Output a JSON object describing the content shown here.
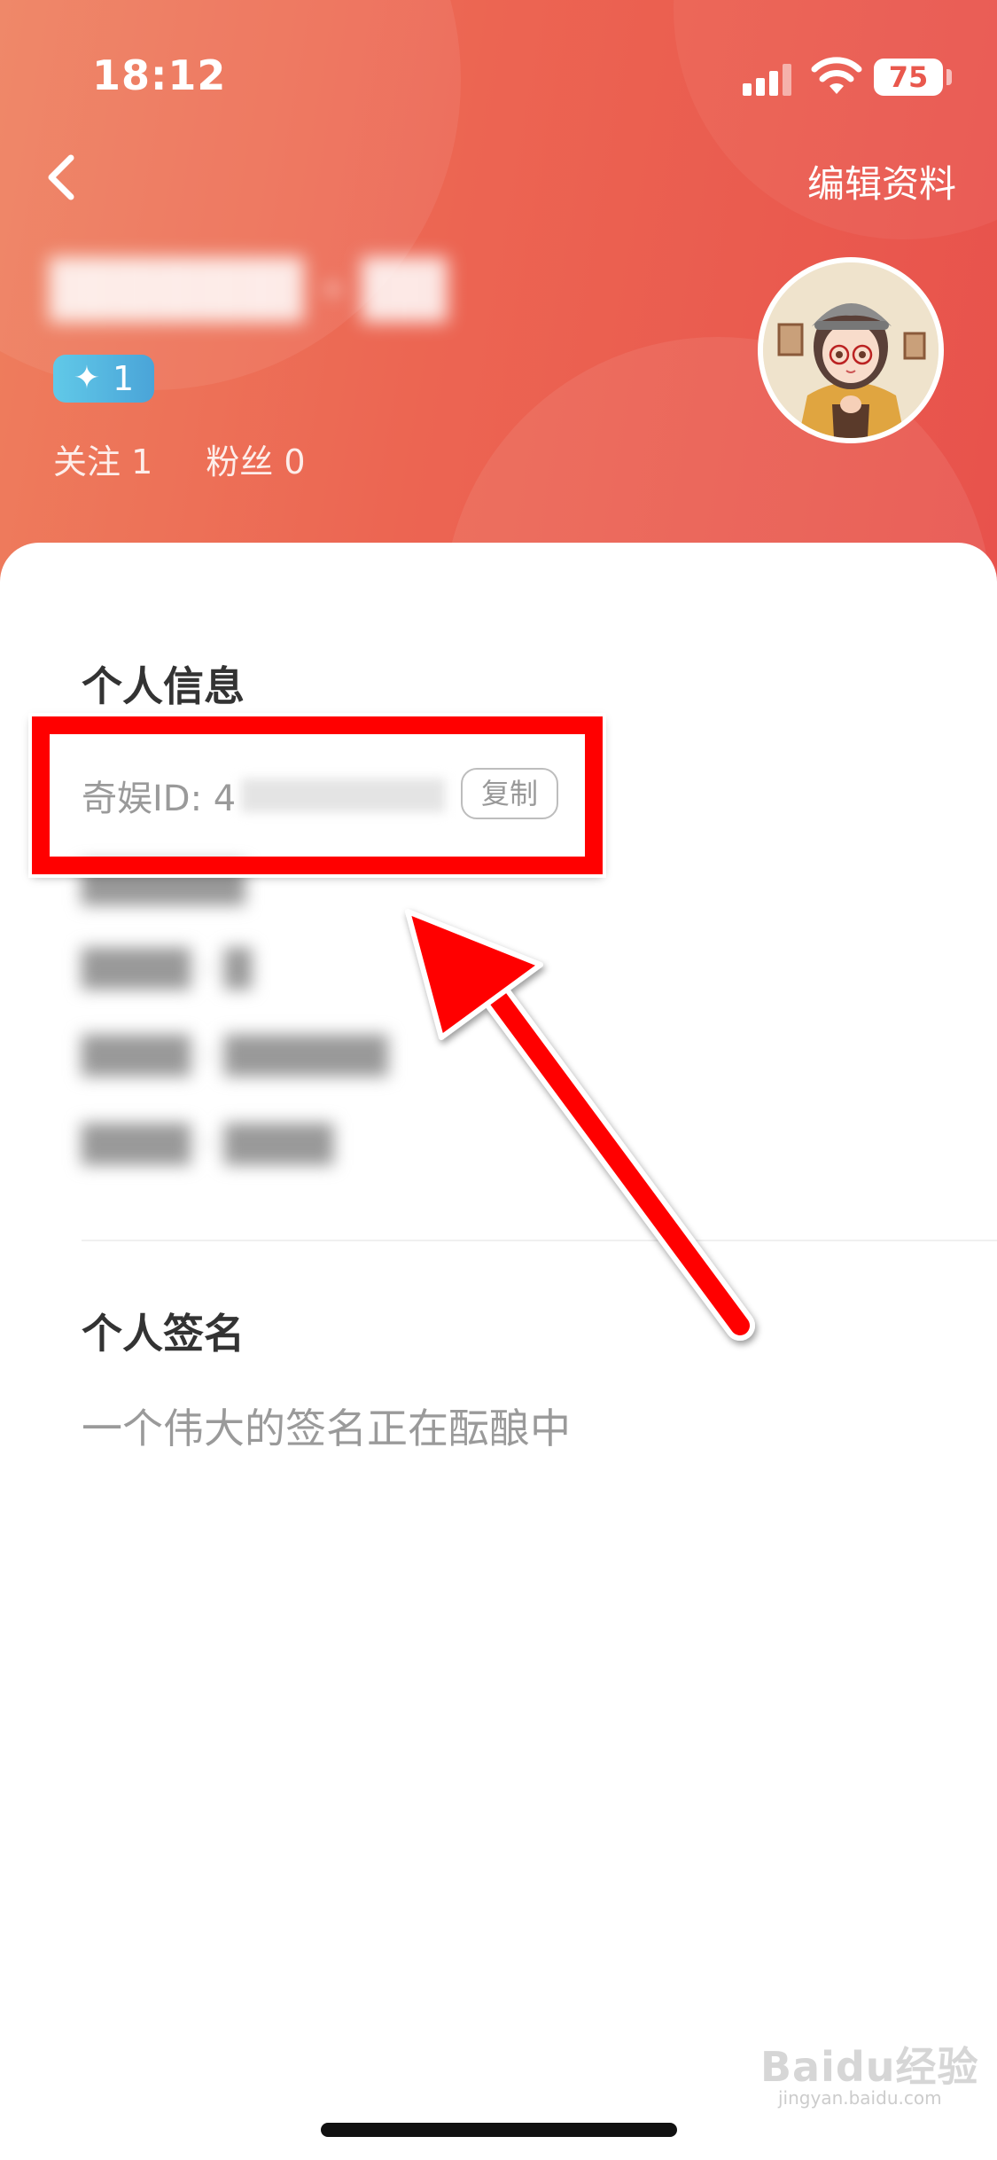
{
  "status_bar": {
    "time": "18:12",
    "battery": "75"
  },
  "nav": {
    "edit_profile_label": "编辑资料"
  },
  "profile": {
    "username_masked": "██████ · ██",
    "level": "1",
    "follow_label": "关注 1",
    "fans_label": "粉丝 0"
  },
  "personal_info": {
    "title": "个人信息",
    "id_label": "奇娱ID: 4",
    "copy_label": "复制",
    "blurred_rows": [
      "██████",
      "████ · █",
      "████ · ██████",
      "████ · ████"
    ]
  },
  "signature": {
    "title": "个人签名",
    "text": "一个伟大的签名正在酝酿中"
  },
  "watermark": {
    "brand": "Baidu经验",
    "url": "jingyan.baidu.com"
  },
  "colors": {
    "header_start": "#ee7f5e",
    "header_end": "#e8524c",
    "highlight": "#ff0000",
    "level_badge": "#55b7e0"
  }
}
